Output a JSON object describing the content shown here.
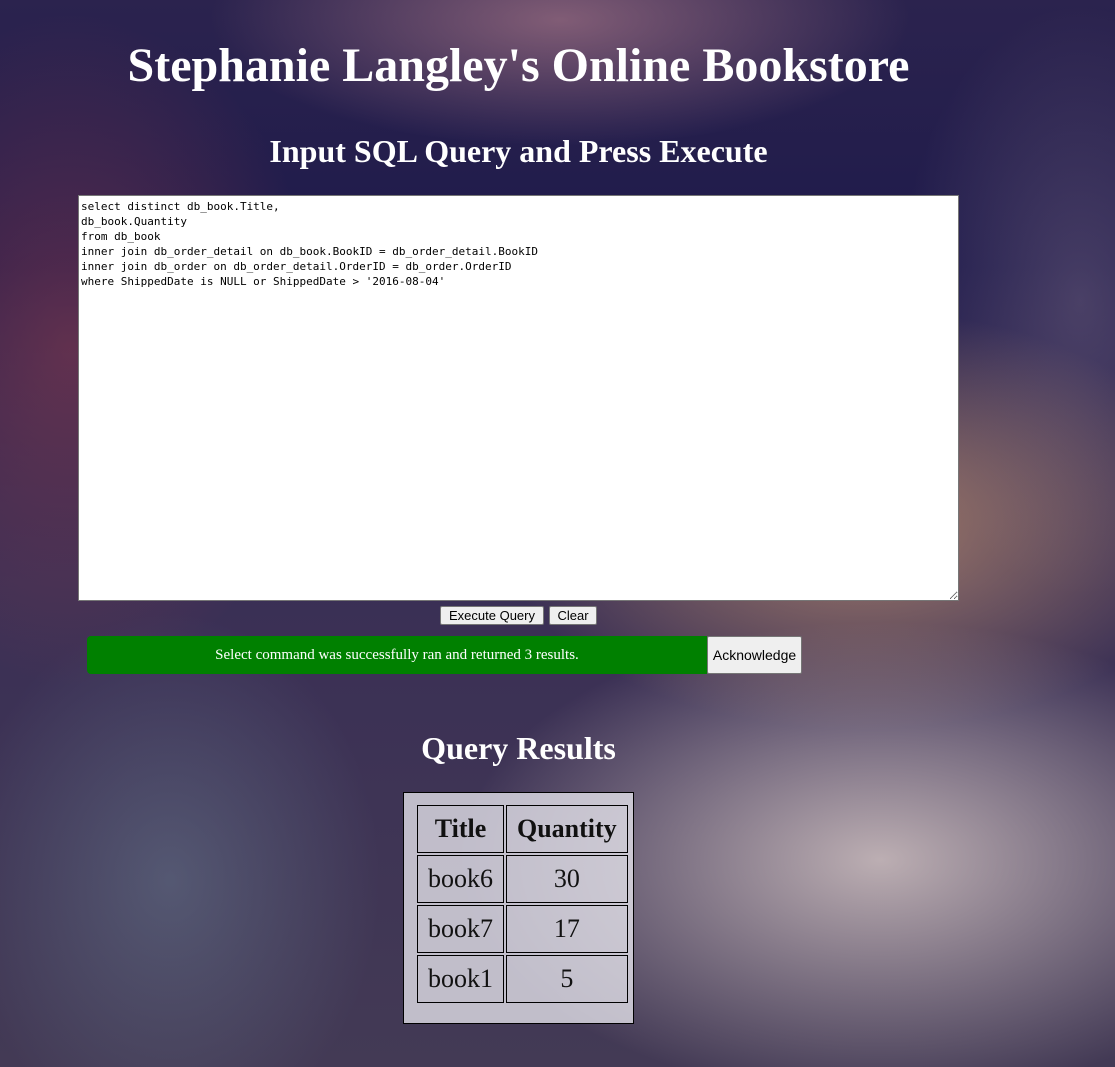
{
  "header": {
    "title": "Stephanie Langley's Online Bookstore",
    "subtitle": "Input SQL Query and Press Execute"
  },
  "query": {
    "text": "select distinct db_book.Title,\ndb_book.Quantity\nfrom db_book\ninner join db_order_detail on db_book.BookID = db_order_detail.BookID\ninner join db_order on db_order_detail.OrderID = db_order.OrderID\nwhere ShippedDate is NULL or ShippedDate > '2016-08-04'"
  },
  "buttons": {
    "execute": "Execute Query",
    "clear": "Clear",
    "acknowledge": "Acknowledge"
  },
  "status": {
    "message": "Select command was successfully ran and returned 3 results.",
    "color": "#008000"
  },
  "results": {
    "heading": "Query Results",
    "columns": [
      "Title",
      "Quantity"
    ],
    "rows": [
      [
        "book6",
        "30"
      ],
      [
        "book7",
        "17"
      ],
      [
        "book1",
        "5"
      ]
    ]
  }
}
